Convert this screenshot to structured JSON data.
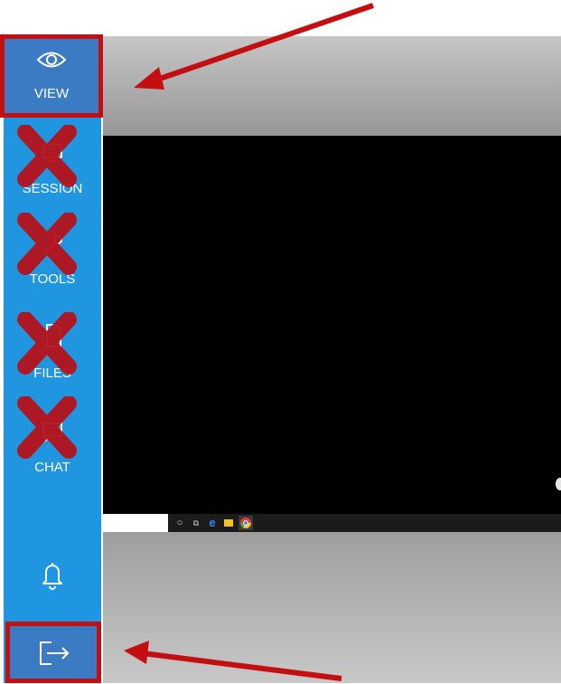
{
  "sidebar": {
    "items": [
      {
        "label": "VIEW",
        "icon": "eye-icon",
        "highlighted": true
      },
      {
        "label": "SESSION",
        "icon": "session-icon",
        "crossed_out": true
      },
      {
        "label": "TOOLS",
        "icon": "tools-icon",
        "crossed_out": true
      },
      {
        "label": "FILES",
        "icon": "files-icon",
        "crossed_out": true
      },
      {
        "label": "CHAT",
        "icon": "chat-icon",
        "crossed_out": true
      }
    ],
    "notifications_icon": "bell-icon",
    "exit_icon": "exit-icon"
  },
  "remote": {
    "taskbar_icons": [
      "circle-icon",
      "task-view-icon",
      "edge-icon",
      "explorer-icon",
      "chrome-icon"
    ]
  },
  "annotations": {
    "arrow_color": "#c40f10",
    "highlight_color": "#c40f10",
    "x_color": "#b5121b"
  },
  "colors": {
    "sidebar_bg": "#2196e0",
    "sidebar_active_bg": "#3a7bc4"
  }
}
